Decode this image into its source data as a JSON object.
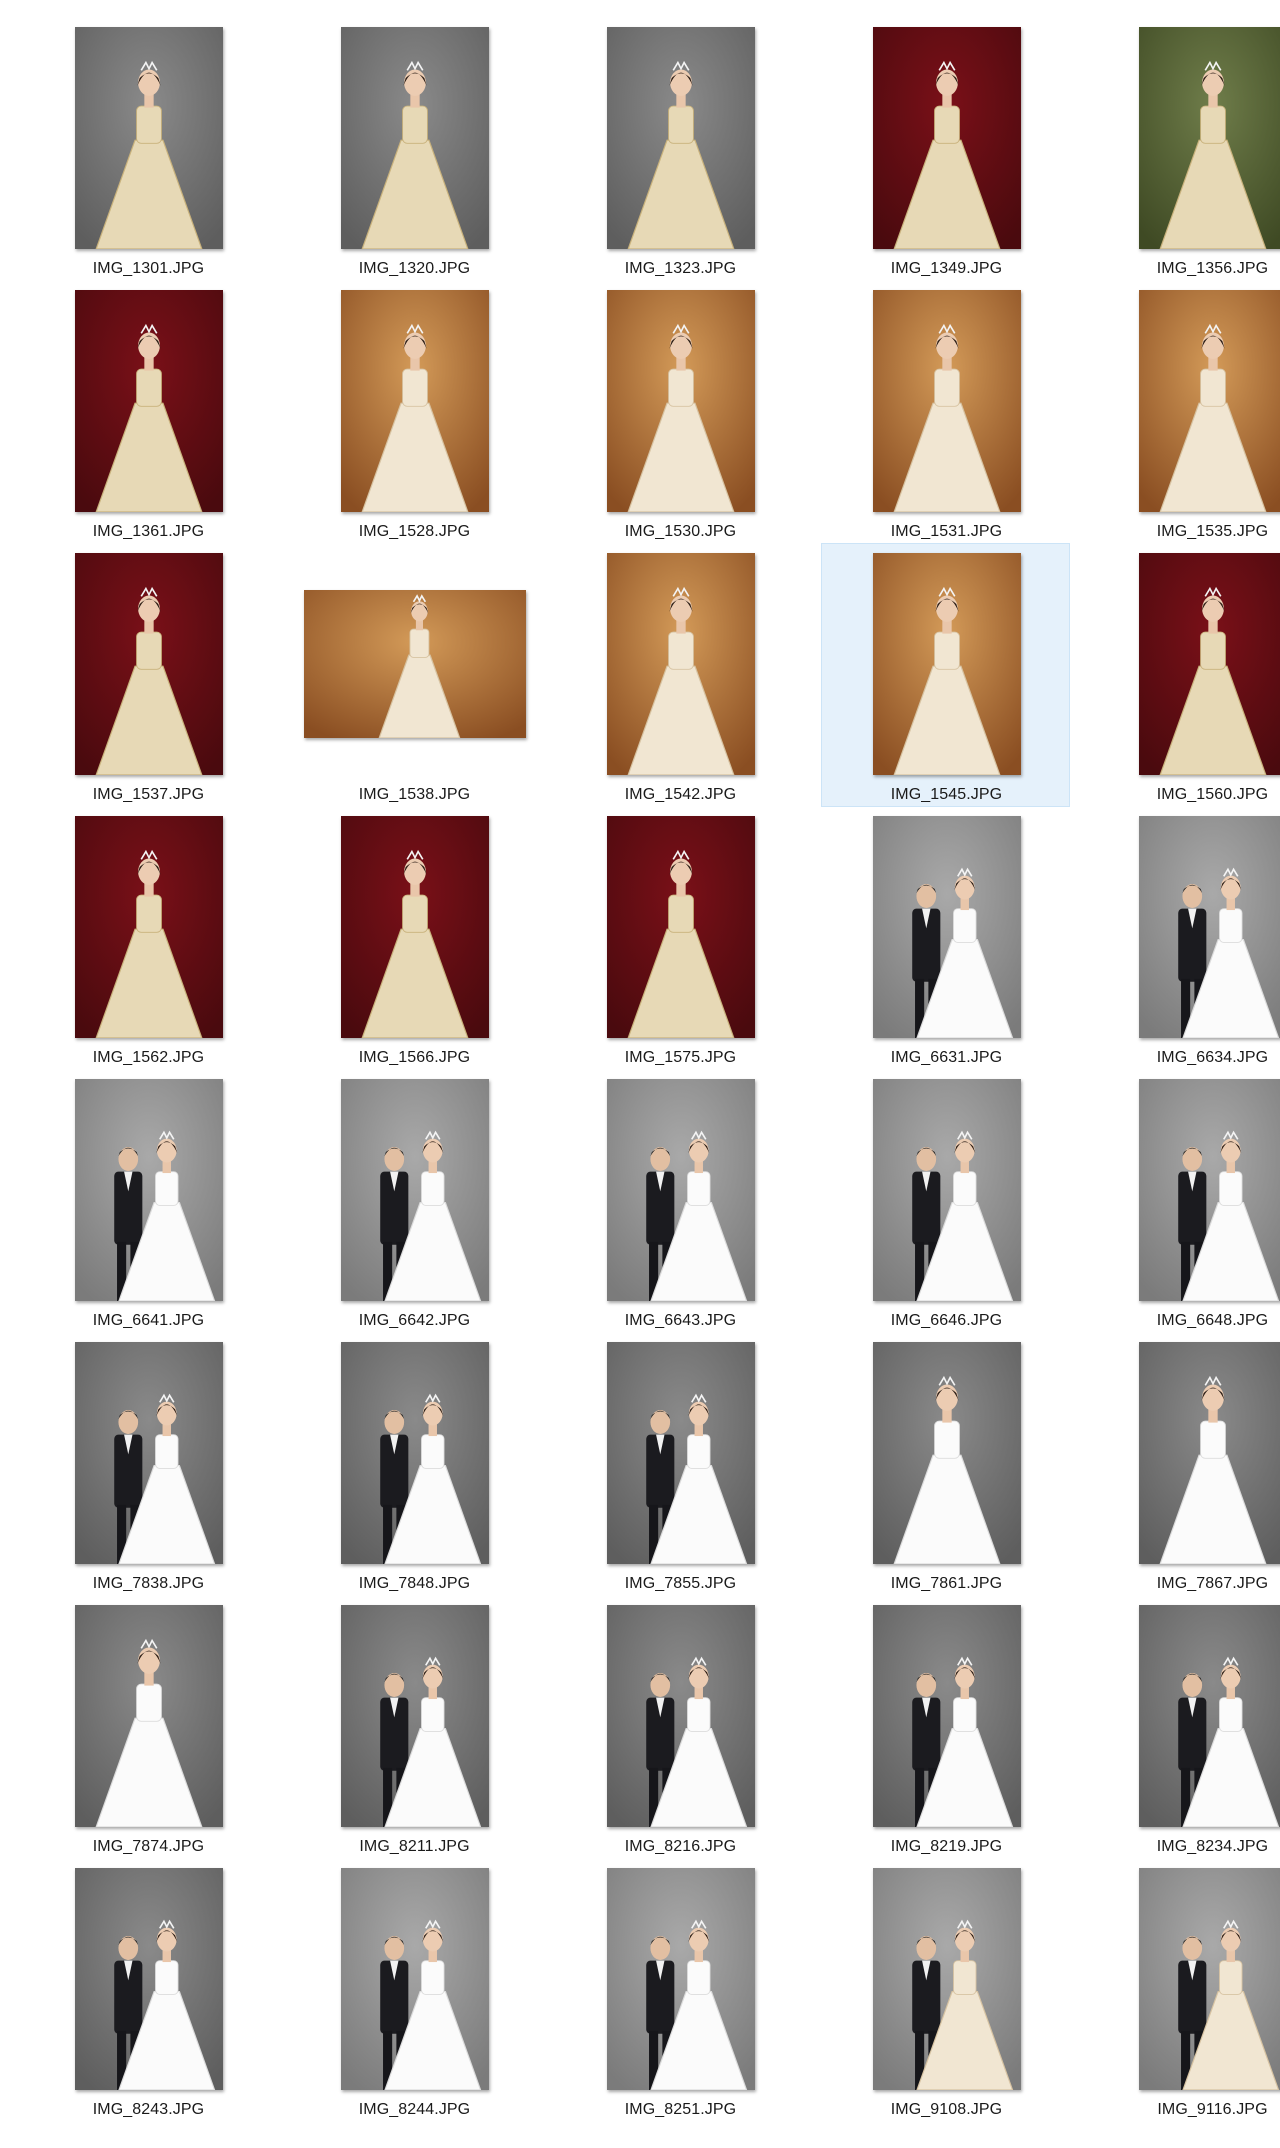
{
  "bg_colors": {
    "gray": [
      "#8a8a8a",
      "#5e5e5e"
    ],
    "red": [
      "#7a1018",
      "#4a0a0e"
    ],
    "warm": [
      "#d39a58",
      "#8a4e22"
    ],
    "lightgray": [
      "#a9a9a9",
      "#7b7b7b"
    ],
    "green": [
      "#6f7d4a",
      "#3f4a24"
    ]
  },
  "files": [
    {
      "name": "IMG_1301.JPG",
      "orientation": "portrait",
      "bg": "gray",
      "dress": "gold",
      "people": 1
    },
    {
      "name": "IMG_1320.JPG",
      "orientation": "portrait",
      "bg": "gray",
      "dress": "gold",
      "people": 1
    },
    {
      "name": "IMG_1323.JPG",
      "orientation": "portrait",
      "bg": "gray",
      "dress": "gold",
      "people": 1
    },
    {
      "name": "IMG_1349.JPG",
      "orientation": "portrait",
      "bg": "red",
      "dress": "gold",
      "people": 1
    },
    {
      "name": "IMG_1356.JPG",
      "orientation": "portrait",
      "bg": "green",
      "dress": "gold",
      "people": 1
    },
    {
      "name": "IMG_1361.JPG",
      "orientation": "portrait",
      "bg": "red",
      "dress": "gold",
      "people": 1
    },
    {
      "name": "IMG_1528.JPG",
      "orientation": "portrait",
      "bg": "warm",
      "dress": "cream",
      "people": 1
    },
    {
      "name": "IMG_1530.JPG",
      "orientation": "portrait",
      "bg": "warm",
      "dress": "cream",
      "people": 1
    },
    {
      "name": "IMG_1531.JPG",
      "orientation": "portrait",
      "bg": "warm",
      "dress": "cream",
      "people": 1
    },
    {
      "name": "IMG_1535.JPG",
      "orientation": "portrait",
      "bg": "warm",
      "dress": "cream",
      "people": 1
    },
    {
      "name": "IMG_1537.JPG",
      "orientation": "portrait",
      "bg": "red",
      "dress": "gold",
      "people": 1
    },
    {
      "name": "IMG_1538.JPG",
      "orientation": "landscape",
      "bg": "warm",
      "dress": "cream",
      "people": 1
    },
    {
      "name": "IMG_1542.JPG",
      "orientation": "portrait",
      "bg": "warm",
      "dress": "cream",
      "people": 1
    },
    {
      "name": "IMG_1545.JPG",
      "orientation": "portrait",
      "bg": "warm",
      "dress": "cream",
      "people": 1,
      "selected": true
    },
    {
      "name": "IMG_1560.JPG",
      "orientation": "portrait",
      "bg": "red",
      "dress": "gold",
      "people": 1
    },
    {
      "name": "IMG_1562.JPG",
      "orientation": "portrait",
      "bg": "red",
      "dress": "gold",
      "people": 1
    },
    {
      "name": "IMG_1566.JPG",
      "orientation": "portrait",
      "bg": "red",
      "dress": "gold",
      "people": 1
    },
    {
      "name": "IMG_1575.JPG",
      "orientation": "portrait",
      "bg": "red",
      "dress": "gold",
      "people": 1
    },
    {
      "name": "IMG_6631.JPG",
      "orientation": "portrait",
      "bg": "lightgray",
      "dress": "white",
      "people": 2
    },
    {
      "name": "IMG_6634.JPG",
      "orientation": "portrait",
      "bg": "lightgray",
      "dress": "white",
      "people": 2
    },
    {
      "name": "IMG_6641.JPG",
      "orientation": "portrait",
      "bg": "lightgray",
      "dress": "white",
      "people": 2
    },
    {
      "name": "IMG_6642.JPG",
      "orientation": "portrait",
      "bg": "lightgray",
      "dress": "white",
      "people": 2
    },
    {
      "name": "IMG_6643.JPG",
      "orientation": "portrait",
      "bg": "lightgray",
      "dress": "white",
      "people": 2
    },
    {
      "name": "IMG_6646.JPG",
      "orientation": "portrait",
      "bg": "lightgray",
      "dress": "white",
      "people": 2
    },
    {
      "name": "IMG_6648.JPG",
      "orientation": "portrait",
      "bg": "lightgray",
      "dress": "white",
      "people": 2
    },
    {
      "name": "IMG_7838.JPG",
      "orientation": "portrait",
      "bg": "gray",
      "dress": "white",
      "people": 2
    },
    {
      "name": "IMG_7848.JPG",
      "orientation": "portrait",
      "bg": "gray",
      "dress": "white",
      "people": 2
    },
    {
      "name": "IMG_7855.JPG",
      "orientation": "portrait",
      "bg": "gray",
      "dress": "white",
      "people": 2
    },
    {
      "name": "IMG_7861.JPG",
      "orientation": "portrait",
      "bg": "gray",
      "dress": "white",
      "people": 1
    },
    {
      "name": "IMG_7867.JPG",
      "orientation": "portrait",
      "bg": "gray",
      "dress": "white",
      "people": 1
    },
    {
      "name": "IMG_7874.JPG",
      "orientation": "portrait",
      "bg": "gray",
      "dress": "white",
      "people": 1
    },
    {
      "name": "IMG_8211.JPG",
      "orientation": "portrait",
      "bg": "gray",
      "dress": "white",
      "people": 2
    },
    {
      "name": "IMG_8216.JPG",
      "orientation": "portrait",
      "bg": "gray",
      "dress": "white",
      "people": 2
    },
    {
      "name": "IMG_8219.JPG",
      "orientation": "portrait",
      "bg": "gray",
      "dress": "white",
      "people": 2
    },
    {
      "name": "IMG_8234.JPG",
      "orientation": "portrait",
      "bg": "gray",
      "dress": "white",
      "people": 2
    },
    {
      "name": "IMG_8243.JPG",
      "orientation": "portrait",
      "bg": "gray",
      "dress": "white",
      "people": 2
    },
    {
      "name": "IMG_8244.JPG",
      "orientation": "portrait",
      "bg": "lightgray",
      "dress": "white",
      "people": 2
    },
    {
      "name": "IMG_8251.JPG",
      "orientation": "portrait",
      "bg": "lightgray",
      "dress": "white",
      "people": 2
    },
    {
      "name": "IMG_9108.JPG",
      "orientation": "portrait",
      "bg": "lightgray",
      "dress": "cream",
      "people": 2
    },
    {
      "name": "IMG_9116.JPG",
      "orientation": "portrait",
      "bg": "lightgray",
      "dress": "cream",
      "people": 2
    }
  ]
}
